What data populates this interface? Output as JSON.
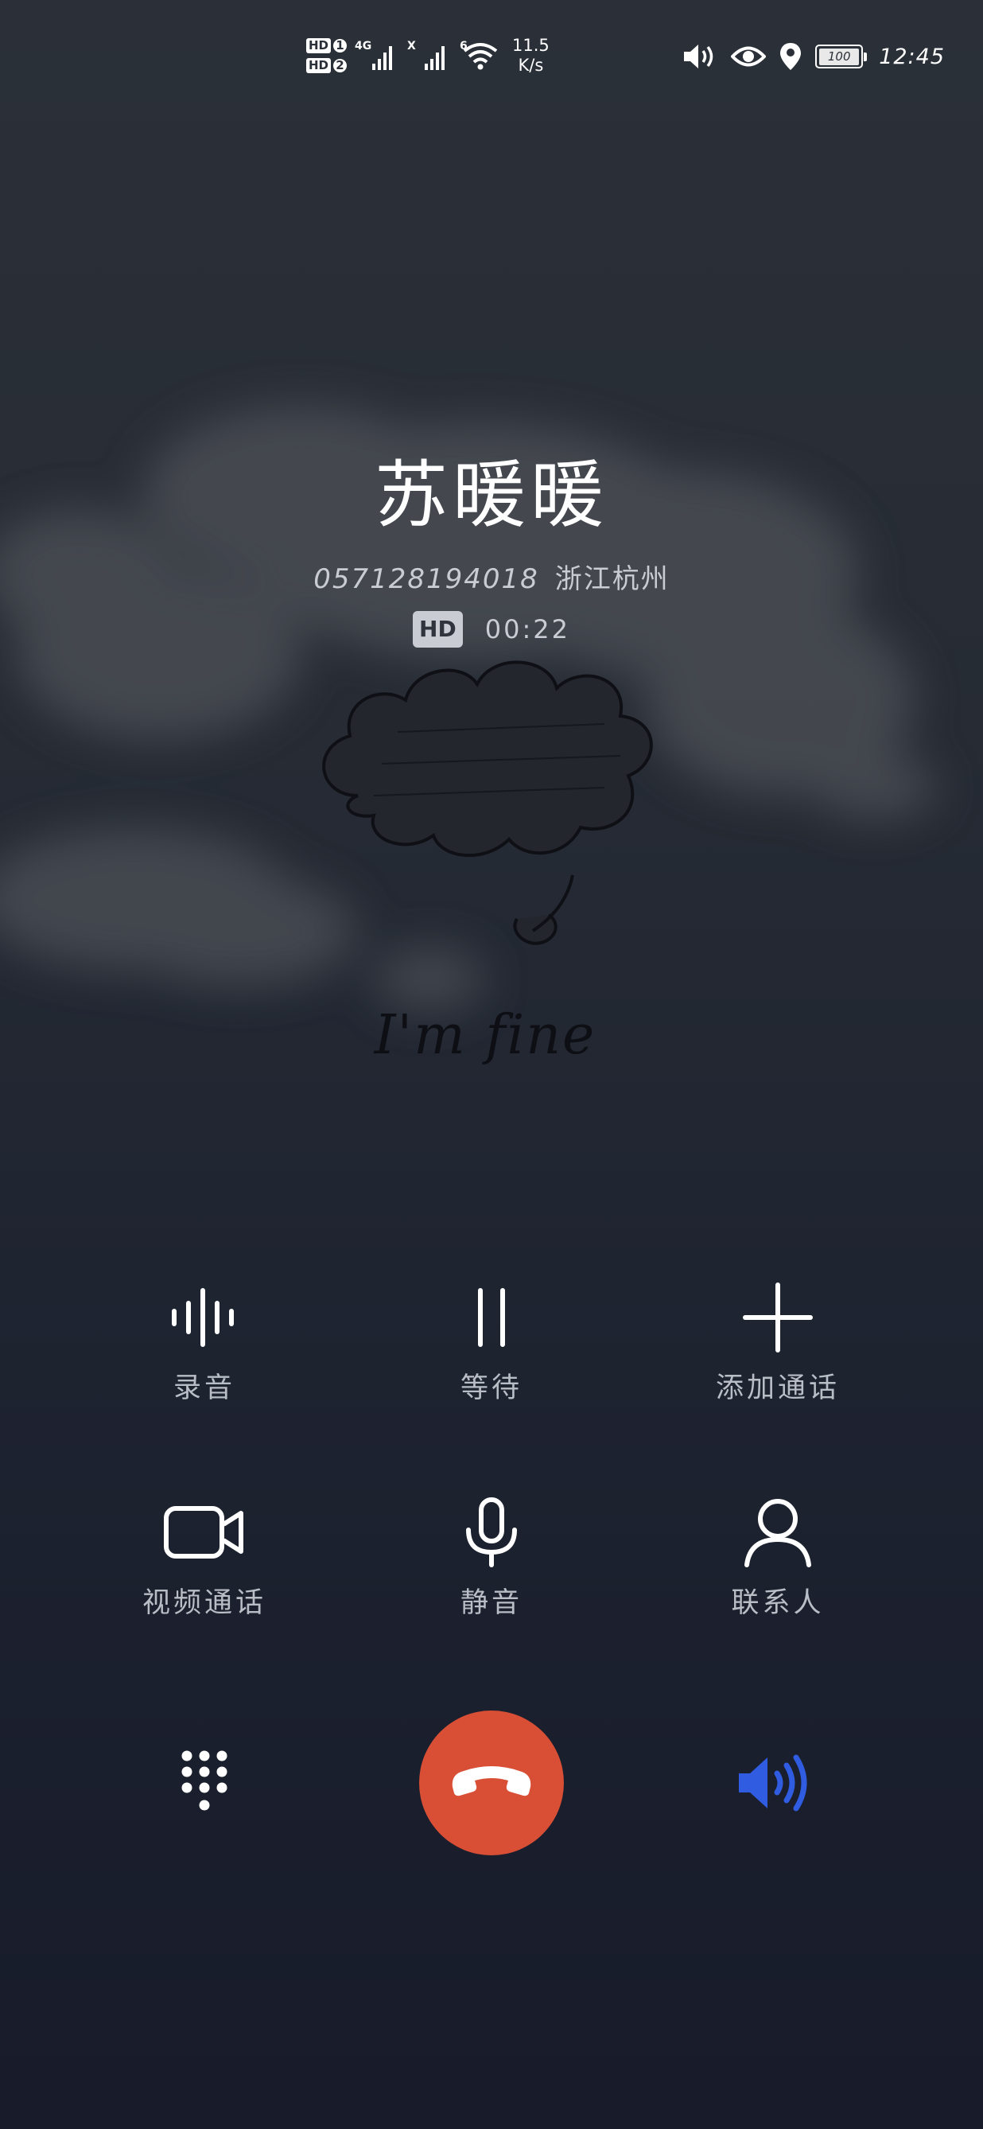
{
  "status_bar": {
    "sim1": "HD",
    "sim1_index": "1",
    "sim2": "HD",
    "sim2_index": "2",
    "network1": "4G",
    "network2": "X",
    "wifi": "6",
    "speed_value": "11.5",
    "speed_unit": "K/s",
    "battery": "100",
    "time": "12:45"
  },
  "call": {
    "name": "苏暖暖",
    "number": "057128194018",
    "location": "浙江杭州",
    "hd_badge": "HD",
    "duration": "00:22"
  },
  "wallpaper": {
    "caption": "I'm fine"
  },
  "controls": {
    "record": "录音",
    "hold": "等待",
    "add_call": "添加通话",
    "video_call": "视频通话",
    "mute": "静音",
    "contacts": "联系人"
  },
  "colors": {
    "end_call": "#d84f35",
    "speaker_active": "#2f5ce0",
    "label": "#b9bdc5"
  },
  "icons": {
    "record": "waveform-icon",
    "hold": "pause-icon",
    "add_call": "plus-icon",
    "video_call": "video-camera-icon",
    "mute": "microphone-icon",
    "contacts": "person-icon",
    "keypad": "dialpad-icon",
    "end_call": "hang-up-icon",
    "speaker": "speaker-icon"
  }
}
